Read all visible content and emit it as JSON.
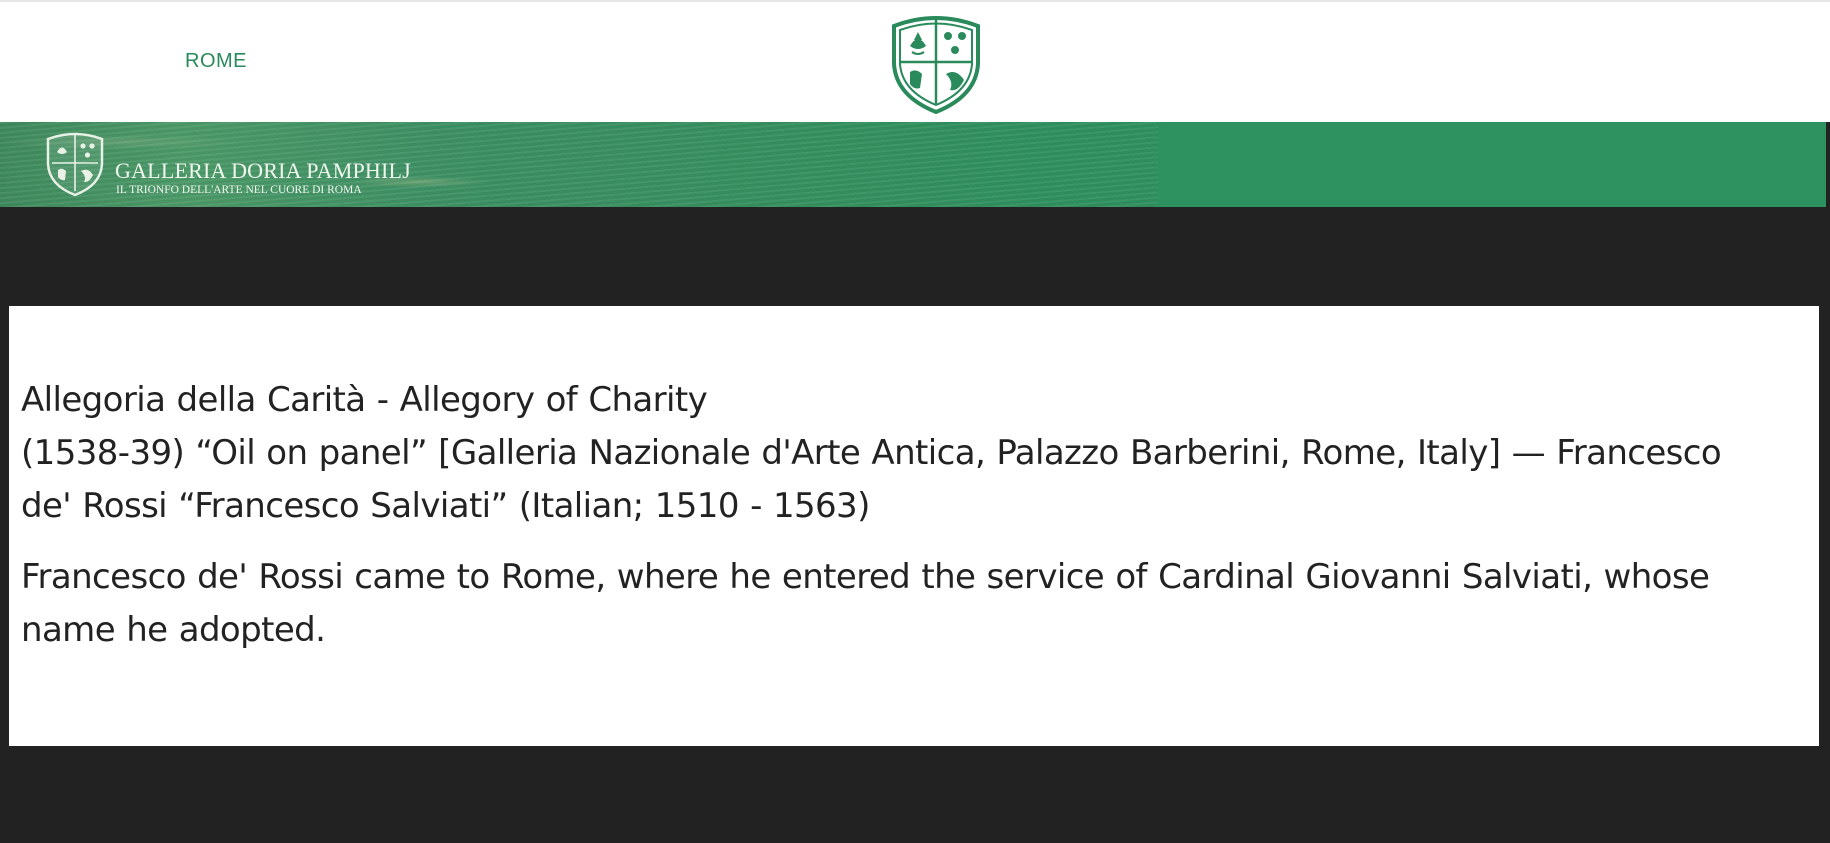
{
  "header": {
    "nav_item": "ROME",
    "crest_icon": "coat-of-arms-icon"
  },
  "banner": {
    "title": "GALLERIA DORIA PAMPHILJ",
    "subtitle": "IL TRIONFO DELL'ARTE NEL CUORE DI ROMA",
    "crest_icon": "coat-of-arms-icon",
    "colors": {
      "banner_green": "#2e9160",
      "nav_green": "#2a8a5c",
      "page_dark": "#222222"
    }
  },
  "article": {
    "title_line": "Allegoria della Carità - Allegory of Charity",
    "details_line_1": "(1538-39) “Oil on panel” [Galleria Nazionale d'Arte Antica, Palazzo Barberini, Rome, Italy] —  Francesco",
    "details_line_2": "de' Rossi “Francesco Salviati” (Italian; 1510 - 1563)",
    "description_line_1": "Francesco de' Rossi came to Rome, where he entered the service of Cardinal Giovanni Salviati, whose",
    "description_line_2": "name he adopted."
  }
}
